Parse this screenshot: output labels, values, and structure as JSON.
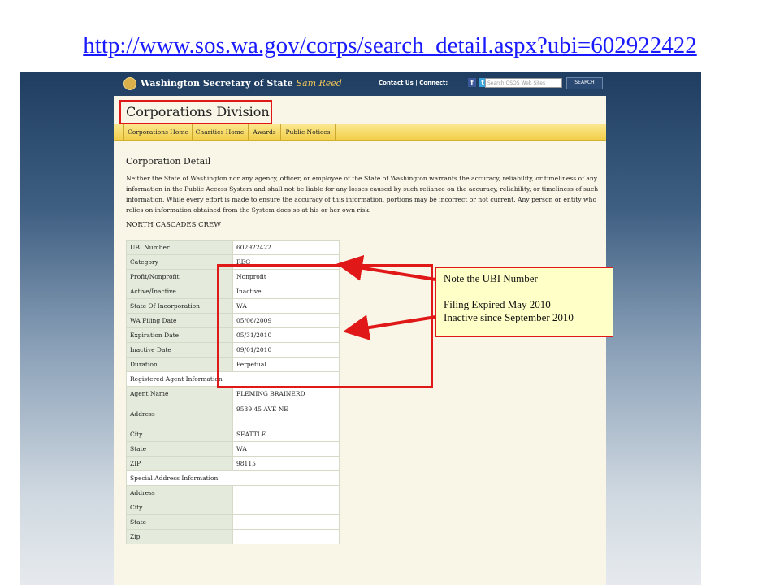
{
  "url": "http://www.sos.wa.gov/corps/search_detail.aspx?ubi=602922422",
  "header": {
    "site_title": "Washington Secretary of State",
    "official_name": "Sam Reed",
    "contact_text": "Contact Us | Connect:",
    "social": [
      "facebook-icon",
      "twitter-icon",
      "youtube-icon"
    ],
    "search_placeholder": "Search OSOS Web Sites",
    "search_button": "SEARCH"
  },
  "division_title": "Corporations Division",
  "nav": {
    "items": [
      "Corporations Home",
      "Charities Home",
      "Awards",
      "Public Notices"
    ]
  },
  "detail": {
    "heading": "Corporation Detail",
    "disclaimer": "Neither the State of Washington nor any agency, officer, or employee of the State of Washington warrants the accuracy, reliability, or timeliness of any information in the Public Access System and shall not be liable for any losses caused by such reliance on the accuracy, reliability, or timeliness of such information. While every effort is made to ensure the accuracy of this information, portions may be incorrect or not current. Any person or entity who relies on information obtained from the System does so at his or her own risk.",
    "corp_name": "NORTH CASCADES CREW",
    "rows": [
      {
        "label": "UBI Number",
        "value": "602922422"
      },
      {
        "label": "Category",
        "value": "REG"
      },
      {
        "label": "Profit/Nonprofit",
        "value": "Nonprofit"
      },
      {
        "label": "Active/Inactive",
        "value": "Inactive"
      },
      {
        "label": "State Of Incorporation",
        "value": "WA"
      },
      {
        "label": "WA Filing Date",
        "value": "05/06/2009"
      },
      {
        "label": "Expiration Date",
        "value": "05/31/2010"
      },
      {
        "label": "Inactive Date",
        "value": "09/01/2010"
      },
      {
        "label": "Duration",
        "value": "Perpetual"
      }
    ],
    "agent_section": "Registered Agent Information",
    "agent_rows": [
      {
        "label": "Agent Name",
        "value": "FLEMING BRAINERD"
      },
      {
        "label": "Address",
        "value": "9539 45 AVE NE"
      },
      {
        "label": "City",
        "value": "SEATTLE"
      },
      {
        "label": "State",
        "value": "WA"
      },
      {
        "label": "ZIP",
        "value": "98115"
      }
    ],
    "special_section": "Special Address Information",
    "special_rows": [
      {
        "label": "Address",
        "value": ""
      },
      {
        "label": "City",
        "value": ""
      },
      {
        "label": "State",
        "value": ""
      },
      {
        "label": "Zip",
        "value": ""
      }
    ]
  },
  "note": {
    "line1": "Note the UBI Number",
    "line2": "Filing Expired May 2010",
    "line3": "Inactive since September 2010"
  },
  "colors": {
    "highlight": "#e01818",
    "link": "#1a1aff",
    "nav": "#f2cf4a"
  }
}
